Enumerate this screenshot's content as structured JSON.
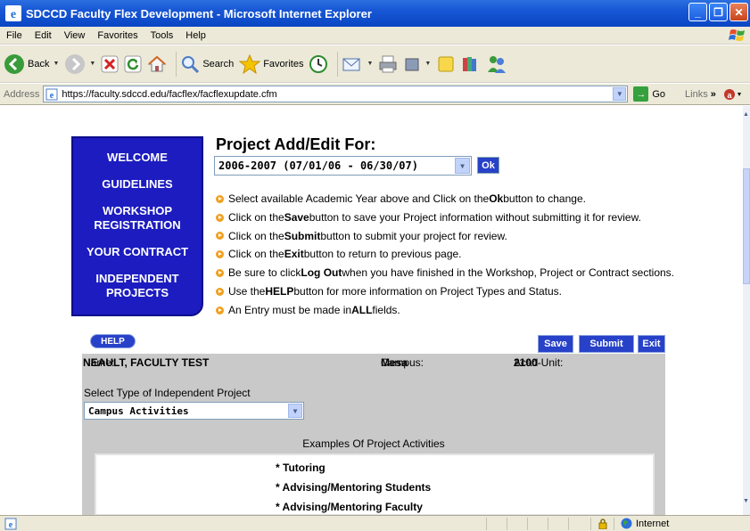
{
  "window": {
    "title": "SDCCD Faculty Flex Development - Microsoft Internet Explorer",
    "buttons": [
      "_",
      "❐",
      "✕"
    ]
  },
  "menu": [
    "File",
    "Edit",
    "View",
    "Favorites",
    "Tools",
    "Help"
  ],
  "toolbar": {
    "back": "Back",
    "search": "Search",
    "favorites": "Favorites"
  },
  "address": {
    "label": "Address",
    "url": "https://faculty.sdccd.edu/facflex/facflexupdate.cfm",
    "go": "Go",
    "links": "Links"
  },
  "nav": {
    "welcome": "WELCOME",
    "guidelines": "GUIDELINES",
    "workshop": "WORKSHOP REGISTRATION",
    "contract": "YOUR CONTRACT",
    "independent": "INDEPENDENT PROJECTS"
  },
  "page": {
    "heading": "Project Add/Edit For:",
    "year_value": "2006-2007 (07/01/06 - 06/30/07)",
    "ok_label": "Ok"
  },
  "instructions": [
    [
      "Select available Academic Year above and Click on the ",
      "Ok",
      " button to change."
    ],
    [
      "Click on the ",
      "Save",
      " button to save your Project information without submitting it for review."
    ],
    [
      "Click on the ",
      "Submit",
      " button to submit your project for review."
    ],
    [
      "Click on the ",
      "Exit",
      " button to return to previous page."
    ],
    [
      "Be sure to click ",
      "Log Out",
      " when you have finished in the Workshop, Project or Contract sections."
    ],
    [
      "Use the ",
      "HELP",
      " button for more information on Project Types and Status."
    ],
    [
      "An Entry must be made in ",
      "ALL",
      " fields."
    ]
  ],
  "actions": {
    "help": "HELP",
    "save": "Save",
    "submit": "Submit",
    "exit": "Exit"
  },
  "project": {
    "name_label": "Name: ",
    "name_value": "NEAULT, FACULTY TEST",
    "campus_label": "Campus: ",
    "campus_value": "Mesa",
    "unit_label": "Acad Unit: ",
    "unit_value": "2100",
    "unit_suffix": " -",
    "type_label": "Select Type of Independent Project",
    "type_value": "Campus Activities",
    "examples_heading": "Examples Of Project Activities",
    "examples": [
      "* Tutoring",
      "* Advising/Mentoring Students",
      "* Advising/Mentoring Faculty"
    ]
  },
  "status": {
    "zone": "Internet"
  },
  "colors": {
    "nav_panel": "#1c1cc0",
    "button_blue": "#2741c8",
    "panel_grey": "#c9c9c9",
    "bullet_orange": "#f0a020"
  }
}
